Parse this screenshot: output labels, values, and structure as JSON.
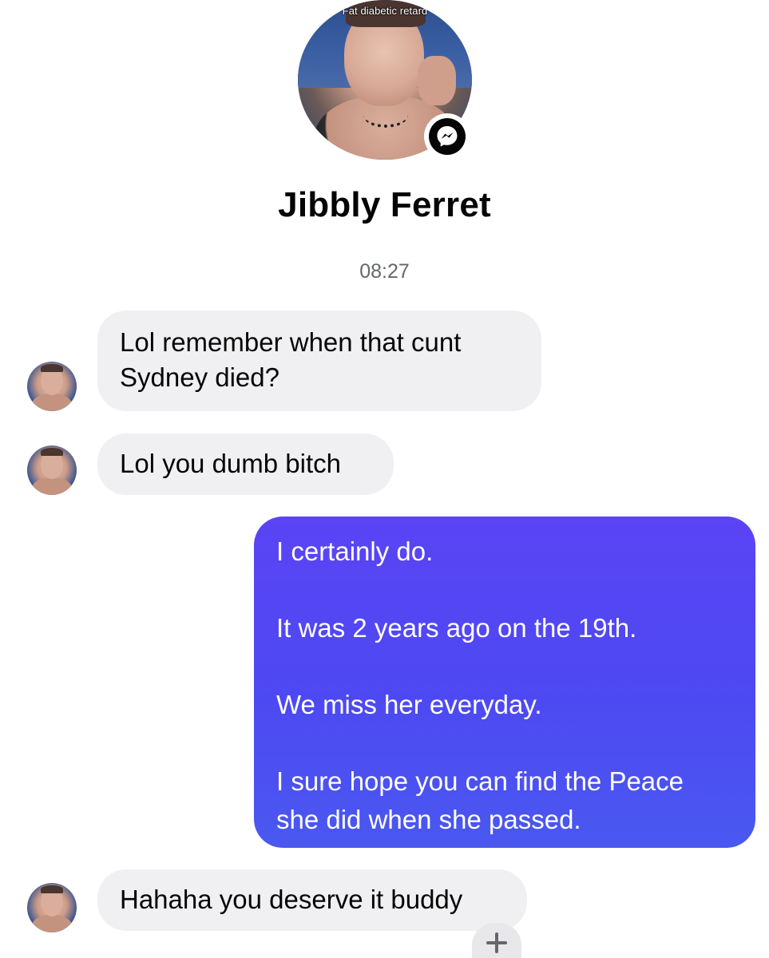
{
  "profile": {
    "avatar_caption": "Fat diabetic retard",
    "name": "Jibbly Ferret",
    "badge_icon": "messenger-icon"
  },
  "conversation": {
    "timestamp": "08:27",
    "messages": [
      {
        "direction": "incoming",
        "text": "Lol remember when that cunt\nSydney died?"
      },
      {
        "direction": "incoming",
        "text": "Lol you dumb bitch"
      },
      {
        "direction": "outgoing",
        "text": "I certainly do.\n\nIt was 2 years ago on the 19th.\n\nWe miss her everyday.\n\nI sure hope you can find the Peace\nshe did when she passed."
      },
      {
        "direction": "incoming",
        "text": "Hahaha you deserve it buddy"
      }
    ]
  },
  "reaction": {
    "icon": "plus-icon"
  },
  "colors": {
    "outgoing_bubble": "#4d49f2",
    "incoming_bubble": "#f0f0f2",
    "timestamp_text": "#65676b"
  }
}
